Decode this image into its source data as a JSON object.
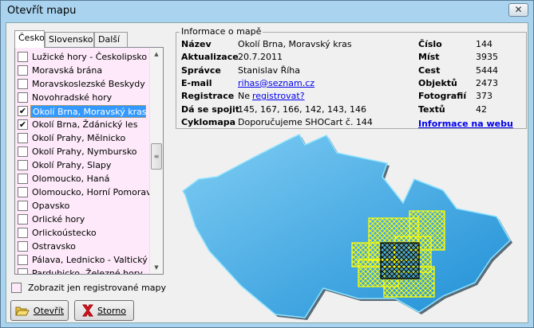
{
  "window": {
    "title": "Otevřít mapu",
    "close": "✕"
  },
  "tabs": [
    "Česko",
    "Slovensko",
    "Další"
  ],
  "maps": [
    {
      "label": "Lužické hory - Českolipsko",
      "checked": false
    },
    {
      "label": "Moravská brána",
      "checked": false
    },
    {
      "label": "Moravskoslezské Beskydy",
      "checked": false
    },
    {
      "label": "Novohradské hory",
      "checked": false
    },
    {
      "label": "Okolí Brna, Moravský kras",
      "checked": true,
      "selected": true
    },
    {
      "label": "Okolí Brna, Ždánický les",
      "checked": true
    },
    {
      "label": "Okolí Prahy, Mělnicko",
      "checked": false
    },
    {
      "label": "Okolí Prahy, Nymbursko",
      "checked": false
    },
    {
      "label": "Okolí Prahy, Slapy",
      "checked": false
    },
    {
      "label": "Olomoucko, Haná",
      "checked": false
    },
    {
      "label": "Olomoucko, Horní Pomoraví",
      "checked": false
    },
    {
      "label": "Opavsko",
      "checked": false
    },
    {
      "label": "Orlické hory",
      "checked": false
    },
    {
      "label": "Orlickoústecko",
      "checked": false
    },
    {
      "label": "Ostravsko",
      "checked": false
    },
    {
      "label": "Pálava, Lednicko - Valtický ...",
      "checked": false
    },
    {
      "label": "Pardubicko, Železné hory",
      "checked": false
    }
  ],
  "only_registered": {
    "label": "Zobrazit jen registrované mapy",
    "checked": false
  },
  "buttons": {
    "open": "Otevřít",
    "cancel": "Storno"
  },
  "info": {
    "title": "Informace o mapě",
    "left": [
      {
        "k": "Název",
        "v": "Okolí Brna, Moravský kras"
      },
      {
        "k": "Aktualizace",
        "v": "20.7.2011"
      },
      {
        "k": "Správce",
        "v": "Stanislav Říha"
      },
      {
        "k": "E-mail",
        "v": "rihas@seznam.cz"
      },
      {
        "k": "Registrace",
        "v": "Ne",
        "link": "registrovat?"
      },
      {
        "k": "Dá se spojit",
        "v": "145, 167, 166, 142, 143, 146"
      },
      {
        "k": "Cyklomapa",
        "v": "Doporučujeme SHOCart č. 144"
      }
    ],
    "right": [
      {
        "k": "Číslo",
        "v": "144"
      },
      {
        "k": "Míst",
        "v": "3935"
      },
      {
        "k": "Cest",
        "v": "5444"
      },
      {
        "k": "Objektů",
        "v": "2473"
      },
      {
        "k": "Fotografií",
        "v": "373"
      },
      {
        "k": "Textů",
        "v": "42"
      }
    ],
    "web_link": "Informace na webu"
  },
  "colors": {
    "map": "#4aaee6",
    "overlay": "#ffff00",
    "selected": "#000000"
  }
}
